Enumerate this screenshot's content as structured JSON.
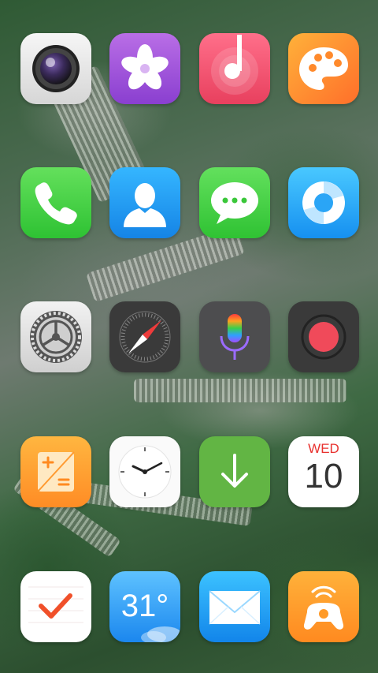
{
  "apps": [
    {
      "name": "camera-app",
      "icon": "camera-lens-icon",
      "bg": [
        "#f4f4f4",
        "#dcdcdc"
      ]
    },
    {
      "name": "photos-app",
      "icon": "flower-icon",
      "bg": [
        "#b96ee6",
        "#8a3fd0"
      ]
    },
    {
      "name": "music-app",
      "icon": "music-note-icon",
      "bg": [
        "#ff6f8a",
        "#e8405e"
      ]
    },
    {
      "name": "themes-app",
      "icon": "palette-icon",
      "bg": [
        "#ffb13a",
        "#ff7a2c"
      ]
    },
    {
      "name": "phone-app",
      "icon": "phone-handset-icon",
      "bg": [
        "#64e05c",
        "#2ec233"
      ]
    },
    {
      "name": "contacts-app",
      "icon": "person-icon",
      "bg": [
        "#35b6ff",
        "#1584e6"
      ]
    },
    {
      "name": "messages-app",
      "icon": "speech-bubble-icon",
      "bg": [
        "#63e05d",
        "#2fc233"
      ]
    },
    {
      "name": "browser-app",
      "icon": "swirl-icon",
      "bg": [
        "#49c8ff",
        "#1690f0"
      ]
    },
    {
      "name": "settings-app",
      "icon": "gear-icon",
      "bg": [
        "#f2f2f2",
        "#cfcfcf"
      ]
    },
    {
      "name": "compass-app",
      "icon": "compass-icon",
      "bg": [
        "#4a4a4a",
        "#2f2f2f"
      ]
    },
    {
      "name": "voice-assistant-app",
      "icon": "microphone-icon",
      "bg": [
        "#5a5a5a",
        "#3d3d3d"
      ]
    },
    {
      "name": "recorder-app",
      "icon": "record-dot-icon",
      "bg": [
        "#4a4a4a",
        "#2f2f2f"
      ]
    },
    {
      "name": "calculator-app",
      "icon": "calculator-icon",
      "bg": [
        "#ffb640",
        "#ff8c25"
      ]
    },
    {
      "name": "clock-app",
      "icon": "clock-face-icon",
      "bg": [
        "#ffffff",
        "#f0f0f0"
      ]
    },
    {
      "name": "downloads-app",
      "icon": "down-arrow-icon",
      "bg": [
        "#6cc04a",
        "#4aa632"
      ]
    },
    {
      "name": "calendar-app",
      "icon": "calendar-icon",
      "bg": [
        "#ffffff",
        "#f2f2f2"
      ]
    },
    {
      "name": "reminders-app",
      "icon": "checkmark-icon",
      "bg": [
        "#ffffff",
        "#f2f2f2"
      ]
    },
    {
      "name": "weather-app",
      "icon": "weather-cloud-icon",
      "bg": [
        "#5ec2ff",
        "#1b87ee"
      ]
    },
    {
      "name": "mail-app",
      "icon": "envelope-icon",
      "bg": [
        "#3cc2ff",
        "#1285ea"
      ]
    },
    {
      "name": "game-center-app",
      "icon": "gamepad-icon",
      "bg": [
        "#ffb13a",
        "#ff8a20"
      ]
    }
  ],
  "calendar": {
    "weekday": "WED",
    "day": "10"
  },
  "weather": {
    "temperature": "31°"
  }
}
